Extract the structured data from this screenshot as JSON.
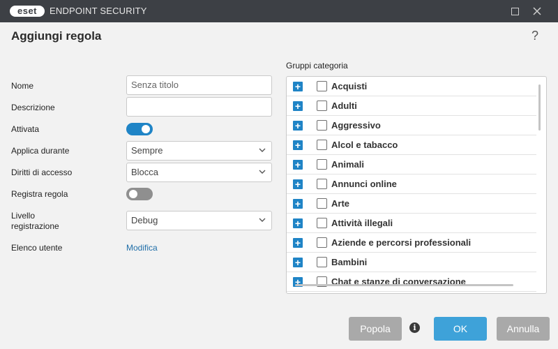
{
  "window": {
    "logo": "eset",
    "title": "ENDPOINT SECURITY"
  },
  "dialog": {
    "title": "Aggiungi regola",
    "help": "?"
  },
  "form": {
    "name_label": "Nome",
    "name_value": "Senza titolo",
    "description_label": "Descrizione",
    "description_value": "",
    "enabled_label": "Attivata",
    "enabled": true,
    "apply_label": "Applica durante",
    "apply_value": "Sempre",
    "access_label": "Diritti di accesso",
    "access_value": "Blocca",
    "log_rule_label": "Registra regola",
    "log_rule": false,
    "log_level_label_line1": "Livello",
    "log_level_label_line2": "registrazione",
    "log_level_value": "Debug",
    "user_list_label": "Elenco utente",
    "user_list_link": "Modifica"
  },
  "categories": {
    "label": "Gruppi categoria",
    "items": [
      "Acquisti",
      "Adulti",
      "Aggressivo",
      "Alcol e tabacco",
      "Animali",
      "Annunci online",
      "Arte",
      "Attività illegali",
      "Aziende e percorsi professionali",
      "Bambini",
      "Chat e stanze di conversazione"
    ]
  },
  "footer": {
    "populate": "Popola",
    "ok": "OK",
    "cancel": "Annulla"
  },
  "colors": {
    "titlebar": "#3d4045",
    "accent": "#1f84c6",
    "ok_button": "#3ea2d9",
    "grey_button": "#a9a9a9"
  }
}
